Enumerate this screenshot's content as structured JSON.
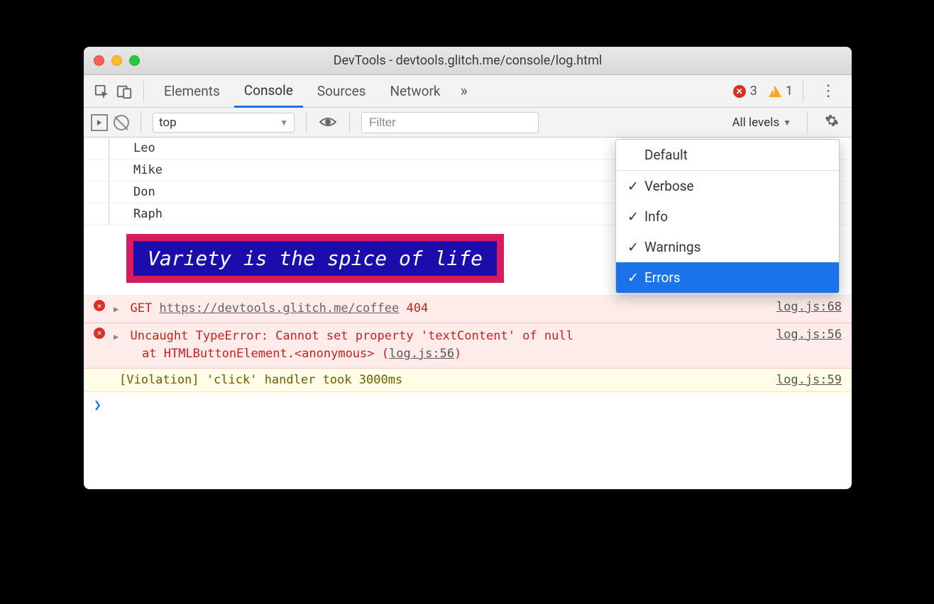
{
  "window": {
    "title": "DevTools - devtools.glitch.me/console/log.html"
  },
  "tabs": {
    "items": [
      "Elements",
      "Console",
      "Sources",
      "Network"
    ],
    "active_index": 1,
    "overflow_glyph": "»"
  },
  "badges": {
    "error_count": "3",
    "warning_count": "1"
  },
  "toolbar": {
    "context_label": "top",
    "filter_placeholder": "Filter",
    "levels_label": "All levels"
  },
  "logs": {
    "tree": [
      "Leo",
      "Mike",
      "Don",
      "Raph"
    ],
    "styled": "Variety is the spice of life",
    "err1": {
      "method": "GET",
      "url": "https://devtools.glitch.me/coffee",
      "status": "404",
      "source": "log.js:68"
    },
    "err2": {
      "line1": "Uncaught TypeError: Cannot set property 'textContent' of null",
      "line2_prefix": "at HTMLButtonElement.<anonymous> (",
      "line2_link": "log.js:56",
      "line2_suffix": ")",
      "source": "log.js:56"
    },
    "violation": {
      "text": "[Violation] 'click' handler took 3000ms",
      "source": "log.js:59"
    }
  },
  "dropdown": {
    "header": "Default",
    "items": [
      {
        "label": "Verbose",
        "checked": true,
        "selected": false
      },
      {
        "label": "Info",
        "checked": true,
        "selected": false
      },
      {
        "label": "Warnings",
        "checked": true,
        "selected": false
      },
      {
        "label": "Errors",
        "checked": true,
        "selected": true
      }
    ]
  },
  "glyphs": {
    "caret_down": "▼",
    "triangle_right": "▶",
    "check": "✓",
    "prompt": "❯"
  }
}
